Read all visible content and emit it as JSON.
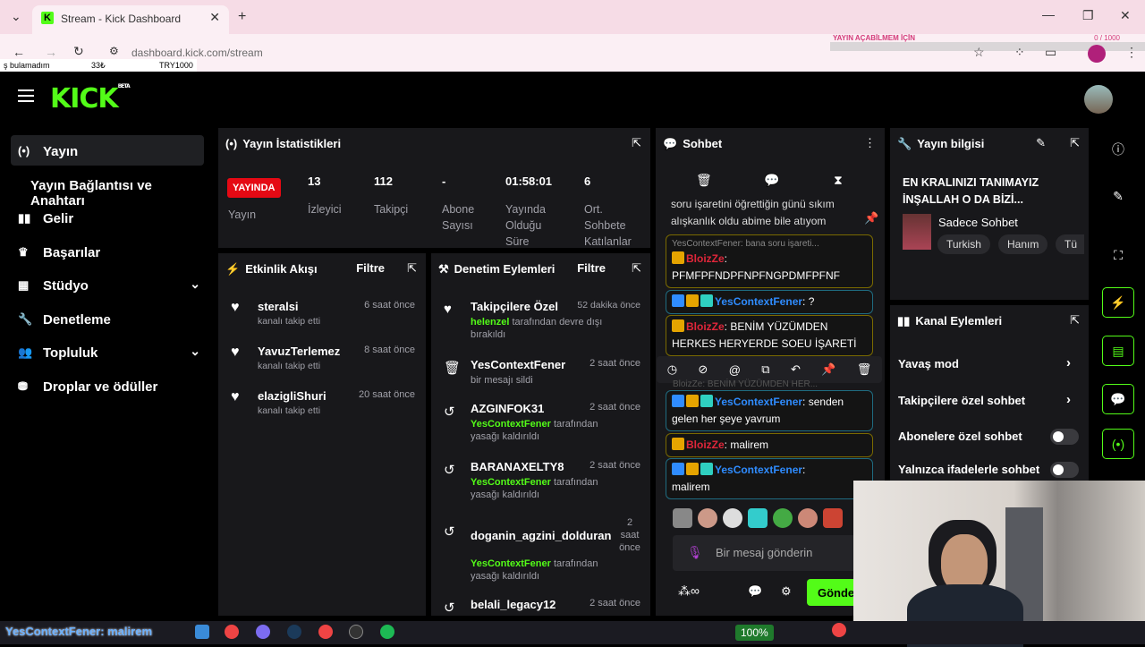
{
  "browser": {
    "tab_title": "Stream - Kick Dashboard",
    "url": "dashboard.kick.com/stream",
    "overlay_left": [
      "ş bulamadım",
      "33₺",
      "TRY1000"
    ],
    "overlay_top_title": "YAYIN AÇABİLMEM İÇİN",
    "overlay_top_count": "0 / 1000"
  },
  "header": {
    "logo": "KICK",
    "logo_sup": "BETA"
  },
  "sidebar": {
    "items": [
      {
        "label": "Yayın",
        "icon": "broadcast-icon"
      },
      {
        "label": "Yayın Bağlantısı ve Anahtarı"
      },
      {
        "label": "Gelir",
        "icon": "chart-icon"
      },
      {
        "label": "Başarılar",
        "icon": "trophy-icon"
      },
      {
        "label": "Stüdyo",
        "icon": "studio-icon"
      },
      {
        "label": "Denetleme",
        "icon": "wrench-icon"
      },
      {
        "label": "Topluluk",
        "icon": "users-icon"
      },
      {
        "label": "Droplar ve ödüller",
        "icon": "gift-icon"
      }
    ]
  },
  "stats": {
    "title": "Yayın İstatistikleri",
    "live": "YAYINDA",
    "yayin": "Yayın",
    "items": [
      {
        "value": "13",
        "label": "İzleyici"
      },
      {
        "value": "112",
        "label": "Takipçi"
      },
      {
        "value": "-",
        "label": "Abone Sayısı"
      },
      {
        "value": "01:58:01",
        "label": "Yayında Olduğu Süre"
      },
      {
        "value": "6",
        "label": "Ort. Sohbete Katılanlar"
      }
    ]
  },
  "activity": {
    "title": "Etkinlik Akışı",
    "filter": "Filtre",
    "items": [
      {
        "name": "steralsi",
        "sub": "kanalı takip etti",
        "time": "6 saat önce"
      },
      {
        "name": "YavuzTerlemez",
        "sub": "kanalı takip etti",
        "time": "8 saat önce"
      },
      {
        "name": "elazigliShuri",
        "sub": "kanalı takip etti",
        "time": "20 saat önce"
      }
    ]
  },
  "moderation": {
    "title": "Denetim Eylemleri",
    "filter": "Filtre",
    "items": [
      {
        "name": "Takipçilere Özel",
        "actor": "helenzel",
        "sub": "tarafından devre dışı bırakıldı",
        "time": "52 dakika önce"
      },
      {
        "name": "YesContextFener",
        "actor": "",
        "sub": "bir mesajı sildi",
        "time": "2 saat önce"
      },
      {
        "name": "AZGINFOK31",
        "actor": "YesContextFener",
        "sub": "tarafından yasağı kaldırıldı",
        "time": "2 saat önce"
      },
      {
        "name": "BARANAXELTY8",
        "actor": "YesContextFener",
        "sub": "tarafından yasağı kaldırıldı",
        "time": "2 saat önce"
      },
      {
        "name": "doganin_agzini_dolduran",
        "actor": "YesContextFener",
        "sub": "tarafından yasağı kaldırıldı",
        "time": "2 saat önce"
      },
      {
        "name": "belali_legacy12",
        "actor": "",
        "sub": "",
        "time": "2 saat önce"
      }
    ]
  },
  "chat": {
    "title": "Sohbet",
    "pinned": "soru işaretini öğrettiğin günü sıkım alışkanlık oldu abime bile atıyom",
    "reply_ctx": "YesContextFener: bana soru işareti...",
    "messages": [
      {
        "user": "BloizZe",
        "text": "PFMFPFNDPFNPFNGPDMFPFNF",
        "style": "gold"
      },
      {
        "user": "YesContextFener",
        "text": "?",
        "style": "blue"
      },
      {
        "user": "BloizZe",
        "text": "BENİM YÜZÜMDEN HERKES HERYERDE SOEU İŞARETİ",
        "style": "gold"
      },
      {
        "user": "YesContextFener",
        "text": "senden gelen her şeye yavrum",
        "style": "blue"
      },
      {
        "user": "BloizZe",
        "text": "malirem",
        "style": "gold"
      },
      {
        "user": "YesContextFener",
        "text": "malirem",
        "style": "blue"
      }
    ],
    "hover_ghost": "BloizZe: BENİM YÜZÜMDEN HER...",
    "input_placeholder": "Bir mesaj gönderin",
    "send": "Gönder"
  },
  "info": {
    "title": "Yayın bilgisi",
    "stream_title": "EN KRALINIZI TANIMAYIZ İNŞALLAH O DA BİZİ...",
    "category": "Sadece Sohbet",
    "tags": [
      "Turkish",
      "Hanım",
      "Tü"
    ]
  },
  "channel": {
    "title": "Kanal Eylemleri",
    "slow": "Yavaş mod",
    "followers": "Takipçilere özel sohbet",
    "subs": "Abonelere özel sohbet",
    "emotes": "Yalnızca ifadelerle sohbet"
  },
  "taskbar": {
    "ticker": "YesContextFener: malirem",
    "battery": "100%"
  },
  "colors": {
    "accent": "#53fc18",
    "live": "#e50914",
    "panel": "#18181b",
    "gold": "#e5a400",
    "blue": "#2f8cff",
    "red": "#e0263a"
  }
}
